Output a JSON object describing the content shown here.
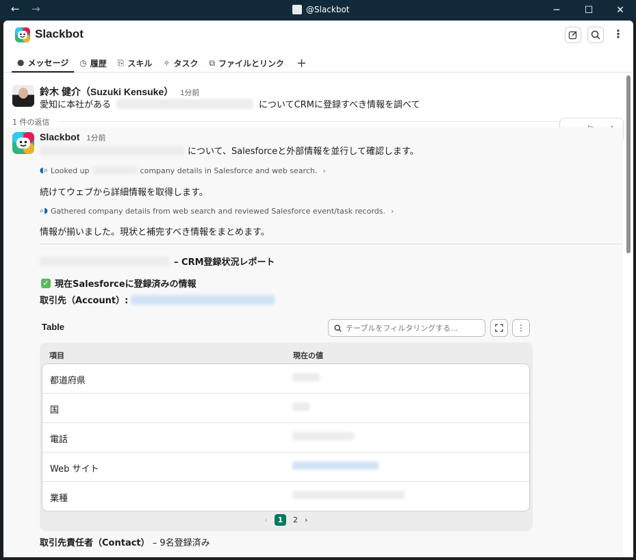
{
  "window": {
    "title": "@Slackbot",
    "back_icon": "←",
    "forward_icon": "→",
    "minimize_icon": "─",
    "maximize_icon": "☐",
    "close_icon": "✕"
  },
  "header": {
    "app_name": "Slackbot",
    "more_icon": "⋮",
    "tabs": [
      {
        "label": "メッセージ",
        "icon": "●"
      },
      {
        "label": "履歴",
        "icon": "◷"
      },
      {
        "label": "スキル",
        "icon": "⎘"
      },
      {
        "label": "タスク",
        "icon": "✧"
      },
      {
        "label": "ファイルとリンク",
        "icon": "⧉"
      }
    ],
    "add_tab": "+"
  },
  "user_message": {
    "author": "鈴木 健介（Suzuki Kensuke）",
    "time": "1分前",
    "text_before": "愛知に本社がある",
    "text_after": "についてCRMに登録すべき情報を調べて"
  },
  "replies": {
    "label": "1 件の返信"
  },
  "bot_message": {
    "author": "Slackbot",
    "time": "1分前",
    "intro_after": "について、Salesforceと外部情報を並行して確認します。",
    "step1_prefix": "Looked up",
    "step1_suffix": "company details in Salesforce and web search.",
    "continue_text": "続けてウェブから詳細情報を取得します。",
    "step2": "Gathered company details from web search and reviewed Salesforce event/task records.",
    "ready_text": "情報が揃いました。現状と補完すべき情報をまとめます。",
    "report_suffix": "– CRM登録状況レポート",
    "section_title": "現在Salesforceに登録済みの情報",
    "account_label": "取引先（Account）:",
    "check_icon": "✓",
    "chevron": "›"
  },
  "hover_toolbar": {
    "share_icon": "↪",
    "bookmark_icon": "⚐",
    "more_icon": "⋮"
  },
  "table": {
    "label": "Table",
    "filter_placeholder": "テーブルをフィルタリングする...",
    "headers": [
      "項目",
      "現在の値"
    ],
    "rows": [
      "都道府県",
      "国",
      "電話",
      "Web サイト",
      "業種"
    ],
    "pager": {
      "prev": "‹",
      "pages": [
        "1",
        "2"
      ],
      "next": "›"
    }
  },
  "contact": {
    "label": "取引先責任者（Contact）",
    "suffix": "– 9名登録済み"
  }
}
